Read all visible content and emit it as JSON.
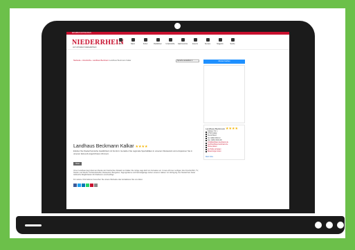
{
  "site": {
    "topbar": "ERLEBEN   ENTDECKEN",
    "logo": "NIEDERRHEIN",
    "logo_sub": "AM UNTEREN NIEDERRHEIN",
    "nav": [
      "Orte",
      "Natur",
      "Kultur",
      "Radfahren",
      "Unterkünfte",
      "Gastronomie",
      "Events",
      "Service",
      "Magazin",
      "Suche"
    ]
  },
  "page": {
    "breadcrumb": "Startseite › Unterkünfte › Landhaus Beckmann",
    "breadcrumb_current": "Landhaus Beckmann Kalkar",
    "lang_select": "Sprache auswählen ▾",
    "title": "Landhaus Beckmann Kalkar",
    "stars": "★★★★",
    "subtitle": "Erleben Sie Niederrheinische Gastlichkeit mit Komfort. Genießen Sie regionale Spezialitäten in unserem Restaurant und entspannen Sie in unseren liebevoll eingerichteten Zimmern.",
    "tag": "Hotel",
    "paragraph": "Unser Landhaus liegt direkt am Rande der historischen Altstadt von Kalkar. Die ruhige Lage lädt zum Verweilen ein. Unsere Zimmer verfügen über Dusche/WC, TV, Telefon und WLAN. Frühstücksbuffet, Restaurant, Biergarten, Tagungsräume und Fahrradgarage stehen unseren Gästen zur Verfügung. Der Niederrhein bietet zahlreiche Möglichkeiten für Radtouren und Ausflüge.",
    "paragraph2": "Für weitere Informationen besuchen Sie unsere Webseite oder kontaktieren Sie uns direkt."
  },
  "sidebar": {
    "button": "Zimmer buchen",
    "card_title": "Landhaus Beckmann",
    "card_stars": "★★★★",
    "rows": [
      "Kalkarer Str. 1",
      "47546 Kalkar",
      "Deutschland",
      "Tel: 02824 9613-0",
      "Fax: 02824 9613-99",
      "info@landhaus-beckmann.de",
      "www.landhaus-beckmann.de",
      "Route planen",
      "Auf Karte anzeigen",
      "Bewertungen lesen"
    ],
    "footer": "Mehr Infos"
  },
  "share_colors": [
    "#3b5998",
    "#1da1f2",
    "#0077b5",
    "#25d366",
    "#c8102e",
    "#888888"
  ]
}
